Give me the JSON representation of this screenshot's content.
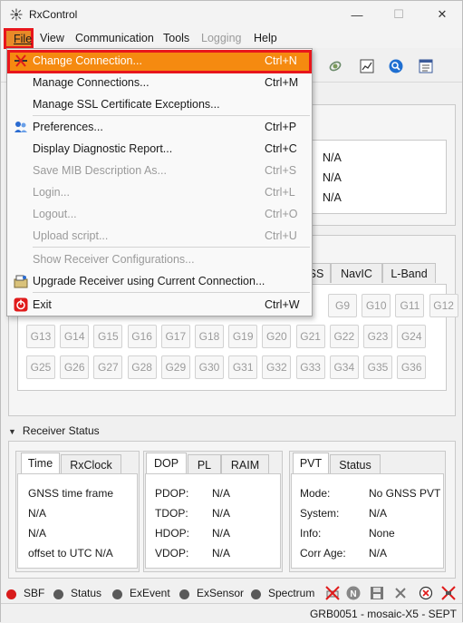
{
  "window": {
    "title": "RxControl",
    "minimize_icon": "minimize-icon",
    "maximize_icon": "maximize-icon",
    "close_icon": "close-icon"
  },
  "menubar": {
    "file": "File",
    "view": "View",
    "communication": "Communication",
    "tools": "Tools",
    "logging": "Logging",
    "help": "Help"
  },
  "file_menu": {
    "items": [
      {
        "label": "Change Connection...",
        "shortcut": "Ctrl+N",
        "enabled": true,
        "highlighted": true,
        "icon": "change-connection-icon"
      },
      {
        "label": "Manage Connections...",
        "shortcut": "Ctrl+M",
        "enabled": true
      },
      {
        "label": "Manage SSL Certificate Exceptions...",
        "shortcut": "",
        "enabled": true
      },
      {
        "label": "Preferences...",
        "shortcut": "Ctrl+P",
        "enabled": true,
        "icon": "preferences-icon"
      },
      {
        "label": "Display Diagnostic Report...",
        "shortcut": "Ctrl+C",
        "enabled": true
      },
      {
        "label": "Save MIB Description As...",
        "shortcut": "Ctrl+S",
        "enabled": false
      },
      {
        "label": "Login...",
        "shortcut": "Ctrl+L",
        "enabled": false
      },
      {
        "label": "Logout...",
        "shortcut": "Ctrl+O",
        "enabled": false
      },
      {
        "label": "Upload script...",
        "shortcut": "Ctrl+U",
        "enabled": false
      },
      {
        "label": "Show Receiver Configurations...",
        "shortcut": "",
        "enabled": false
      },
      {
        "label": "Upgrade Receiver using Current Connection...",
        "shortcut": "",
        "enabled": true,
        "icon": "upgrade-receiver-icon"
      },
      {
        "label": "Exit",
        "shortcut": "Ctrl+W",
        "enabled": true,
        "icon": "exit-icon"
      }
    ]
  },
  "info_panel": {
    "values": [
      "N/A",
      "N/A",
      "N/A"
    ]
  },
  "constellation_tabs": {
    "partial": "SS",
    "navic": "NavIC",
    "lband": "L-Band"
  },
  "sat_buttons": {
    "row1": [
      "G9",
      "G10",
      "G11",
      "G12"
    ],
    "row2": [
      "G13",
      "G14",
      "G15",
      "G16",
      "G17",
      "G18",
      "G19",
      "G20",
      "G21",
      "G22",
      "G23",
      "G24"
    ],
    "row3": [
      "G25",
      "G26",
      "G27",
      "G28",
      "G29",
      "G30",
      "G31",
      "G32",
      "G33",
      "G34",
      "G35",
      "G36"
    ]
  },
  "receiver_status": {
    "header": "Receiver Status",
    "time_tabs": {
      "time": "Time",
      "rxclock": "RxClock"
    },
    "time_lines": [
      "GNSS time frame",
      "N/A",
      "N/A",
      "offset to UTC N/A"
    ],
    "dop_tabs": {
      "dop": "DOP",
      "pl": "PL",
      "raim": "RAIM"
    },
    "dop_rows": [
      {
        "label": "PDOP:",
        "value": "N/A"
      },
      {
        "label": "TDOP:",
        "value": "N/A"
      },
      {
        "label": "HDOP:",
        "value": "N/A"
      },
      {
        "label": "VDOP:",
        "value": "N/A"
      }
    ],
    "pvt_tabs": {
      "pvt": "PVT",
      "status": "Status"
    },
    "pvt_rows": [
      {
        "label": "Mode:",
        "value": "No GNSS PVT"
      },
      {
        "label": "System:",
        "value": "N/A"
      },
      {
        "label": "Info:",
        "value": "None"
      },
      {
        "label": "Corr Age:",
        "value": "N/A"
      }
    ]
  },
  "status_leds": [
    {
      "label": "SBF",
      "color": "#d81b1b"
    },
    {
      "label": "Status",
      "color": "#5a5a5a"
    },
    {
      "label": "ExEvent",
      "color": "#5a5a5a"
    },
    {
      "label": "ExSensor",
      "color": "#5a5a5a"
    },
    {
      "label": "Spectrum",
      "color": "#5a5a5a"
    }
  ],
  "bottom_status": "GRB0051 - mosaic-X5 - SEPT",
  "colors": {
    "highlight": "#f58a10",
    "highlight_border": "#e8161c",
    "accent_blue": "#1f6fd1"
  }
}
